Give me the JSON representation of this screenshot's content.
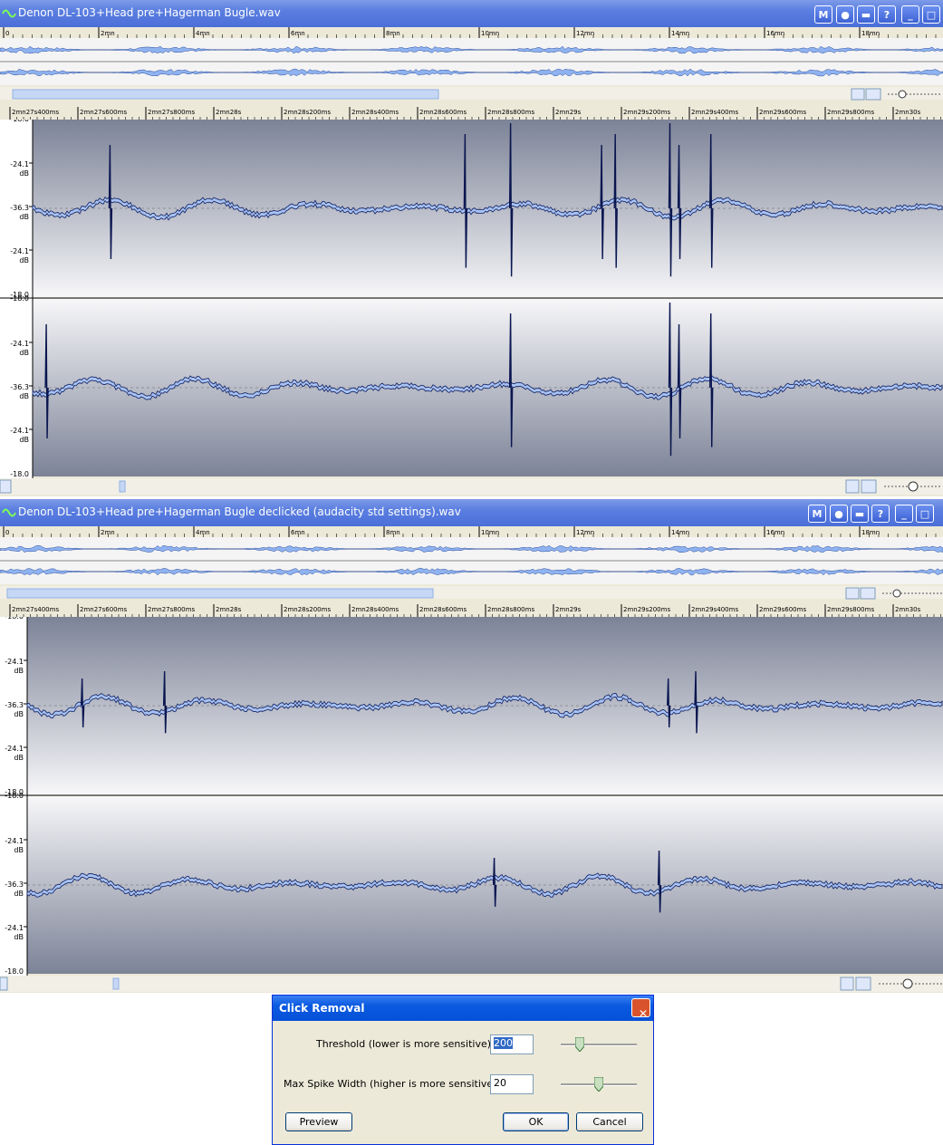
{
  "windows": [
    {
      "title": "Denon DL-103+Head pre+Hagerman Bugle.wav",
      "buttons": [
        "M",
        "",
        "",
        "?",
        "",
        ""
      ],
      "overview_ticks": [
        "0",
        "2mn",
        "4mn",
        "6mn",
        "8mn",
        "10mn",
        "12mn",
        "14mn",
        "16mn",
        "18mn"
      ],
      "time_ticks": [
        "2mn27s400ms",
        "2mn27s600ms",
        "2mn27s800ms",
        "2mn28s",
        "2mn28s200ms",
        "2mn28s400ms",
        "2mn28s600ms",
        "2mn28s800ms",
        "2mn29s",
        "2mn29s200ms",
        "2mn29s400ms",
        "2mn29s600ms",
        "2mn29s800ms",
        "2mn30s"
      ],
      "db_labels": [
        "-18.0",
        "-24.1",
        "dB",
        "-36.3",
        "dB",
        "-24.1",
        "dB",
        "-18.0"
      ],
      "spikes_ch1": [
        0.085,
        0.475,
        0.525,
        0.625,
        0.64,
        0.7,
        0.71,
        0.745
      ],
      "spikes_ch2": [
        0.015,
        0.525,
        0.7,
        0.71,
        0.745
      ]
    },
    {
      "title": "Denon DL-103+Head pre+Hagerman Bugle declicked (audacity std settings).wav",
      "buttons": [
        "M",
        "",
        "",
        "?",
        "",
        ""
      ],
      "overview_ticks": [
        "0",
        "2mn",
        "4mn",
        "6mn",
        "8mn",
        "10mn",
        "12mn",
        "14mn",
        "16mn",
        "18mn"
      ],
      "time_ticks": [
        "2mn27s400ms",
        "2mn27s600ms",
        "2mn27s800ms",
        "2mn28s",
        "2mn28s200ms",
        "2mn28s400ms",
        "2mn28s600ms",
        "2mn28s800ms",
        "2mn29s",
        "2mn29s200ms",
        "2mn29s400ms",
        "2mn29s600ms",
        "2mn29s800ms",
        "2mn30s"
      ],
      "db_labels": [
        "-18.0",
        "-24.1",
        "dB",
        "-36.3",
        "dB",
        "-24.1",
        "dB",
        "-18.0"
      ],
      "spikes_ch1": [
        0.06,
        0.15,
        0.7,
        0.73
      ],
      "spikes_ch2": [
        0.51,
        0.69
      ]
    }
  ],
  "dialog": {
    "title": "Click Removal",
    "threshold_label": "Threshold (lower is more sensitive):",
    "threshold_value": "200",
    "threshold_slider": 0.22,
    "spike_label": "Max Spike Width (higher is more sensitive):",
    "spike_value": "20",
    "spike_slider": 0.5,
    "preview_label": "Preview",
    "ok_label": "OK",
    "cancel_label": "Cancel"
  }
}
